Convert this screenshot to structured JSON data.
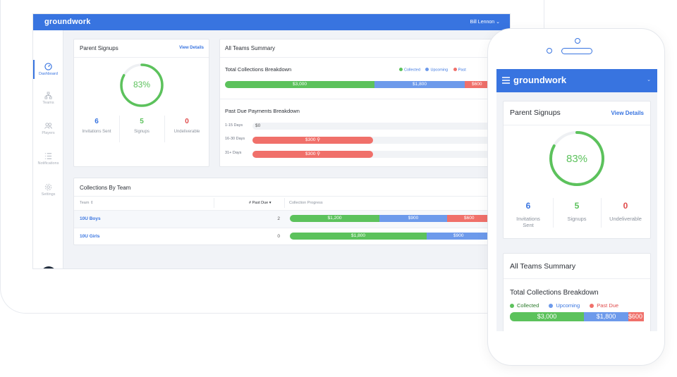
{
  "brand": "groundwork",
  "user": {
    "name": "Bill Lennon"
  },
  "colors": {
    "primary": "#3874e0",
    "collected": "#5cc25c",
    "upcoming": "#6d9aeb",
    "past_due": "#f0706a",
    "dark": "#1f2a3a"
  },
  "sidebar": {
    "items": [
      {
        "label": "Dashboard",
        "icon": "dashboard-icon",
        "active": true
      },
      {
        "label": "Teams",
        "icon": "teams-icon",
        "active": false
      },
      {
        "label": "Players",
        "icon": "players-icon",
        "active": false
      },
      {
        "label": "Notifications",
        "icon": "notifications-icon",
        "active": false
      },
      {
        "label": "Settings",
        "icon": "gear-icon",
        "active": false
      }
    ],
    "chat_icon": "chat-icon"
  },
  "parent_signups": {
    "title": "Parent Signups",
    "link": "View Details",
    "percent": 83,
    "percent_label": "83%",
    "stats": [
      {
        "value": "6",
        "label": "Invitations Sent",
        "color": "#3874e0"
      },
      {
        "value": "5",
        "label": "Signups",
        "color": "#5cc25c"
      },
      {
        "value": "0",
        "label": "Undeliverable",
        "color": "#e04b4b"
      }
    ]
  },
  "summary": {
    "title": "All Teams Summary",
    "breakdown_title": "Total Collections Breakdown",
    "legend": [
      "Collected",
      "Upcoming",
      "Past Due"
    ],
    "legend_desktop_cut": "Past",
    "collected": {
      "label": "$3,000",
      "value": 3000
    },
    "upcoming": {
      "label": "$1,800",
      "value": 1800
    },
    "past_due": {
      "label": "$600",
      "value": 600
    },
    "past_due_title": "Past Due Payments Breakdown",
    "past_due_rows": [
      {
        "label": "1-15 Days",
        "value": "$0",
        "amount": 0
      },
      {
        "label": "16-30 Days",
        "value": "$300",
        "amount": 300
      },
      {
        "label": "31+ Days",
        "value": "$300",
        "amount": 300
      }
    ]
  },
  "collections_by_team": {
    "title": "Collections By Team",
    "headers": {
      "team": "Team",
      "past_due": "# Past Due",
      "progress": "Collection Progress"
    },
    "rows": [
      {
        "team": "10U Boys",
        "past_due": "2",
        "collected": "$1,200",
        "upcoming": "$900",
        "pastdue": "$600"
      },
      {
        "team": "10U Girls",
        "past_due": "0",
        "collected": "$1,800",
        "upcoming": "$900",
        "pastdue": ""
      }
    ]
  },
  "mobile": {
    "brand": "groundwork",
    "stats_labels": [
      "Invitations\nSent",
      "Signups",
      "Undeliverable"
    ],
    "invitations_line1": "Invitations",
    "invitations_line2": "Sent",
    "past_due_cut": "$600"
  }
}
